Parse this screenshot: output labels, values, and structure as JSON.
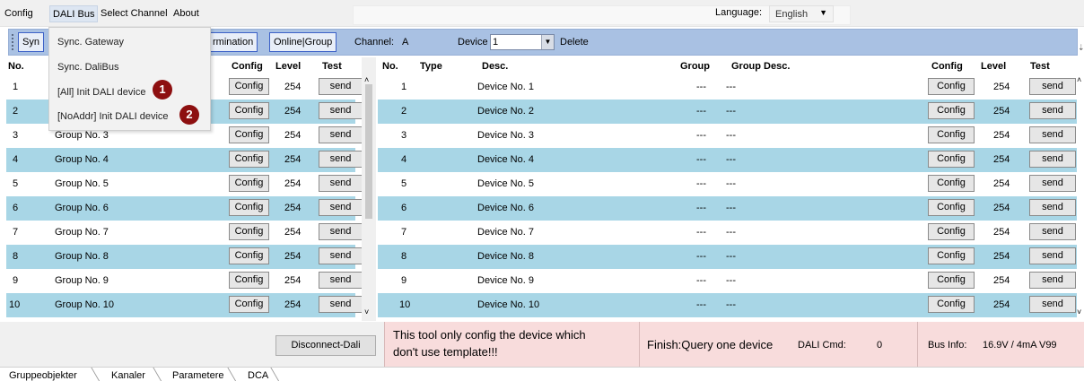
{
  "menubar": {
    "items": [
      "Config",
      "DALI Bus",
      "Select Channel",
      "About"
    ],
    "language_label": "Language:",
    "language_value": "English"
  },
  "dropdown": {
    "items": [
      "Sync. Gateway",
      "Sync. DaliBus",
      "[All] Init DALI device",
      "[NoAddr] Init DALI device"
    ],
    "badges": [
      "1",
      "2"
    ]
  },
  "toolbar": {
    "sync_partial": "Syn",
    "termination_partial": "rmination",
    "online_group": "Online|Group",
    "channel_label": "Channel:",
    "channel_value": "A",
    "device_label": "Device",
    "device_value": "1",
    "delete_label": "Delete"
  },
  "left_table": {
    "headers": {
      "no": "No.",
      "config": "Config",
      "level": "Level",
      "test": "Test"
    },
    "rows": [
      {
        "no": "1",
        "name": "",
        "config": "Config",
        "level": "254",
        "test": "send"
      },
      {
        "no": "2",
        "name": "",
        "config": "Config",
        "level": "254",
        "test": "send"
      },
      {
        "no": "3",
        "name": "Group No. 3",
        "config": "Config",
        "level": "254",
        "test": "send"
      },
      {
        "no": "4",
        "name": "Group No. 4",
        "config": "Config",
        "level": "254",
        "test": "send"
      },
      {
        "no": "5",
        "name": "Group No. 5",
        "config": "Config",
        "level": "254",
        "test": "send"
      },
      {
        "no": "6",
        "name": "Group No. 6",
        "config": "Config",
        "level": "254",
        "test": "send"
      },
      {
        "no": "7",
        "name": "Group No. 7",
        "config": "Config",
        "level": "254",
        "test": "send"
      },
      {
        "no": "8",
        "name": "Group No. 8",
        "config": "Config",
        "level": "254",
        "test": "send"
      },
      {
        "no": "9",
        "name": "Group No. 9",
        "config": "Config",
        "level": "254",
        "test": "send"
      },
      {
        "no": "10",
        "name": "Group No. 10",
        "config": "Config",
        "level": "254",
        "test": "send"
      }
    ]
  },
  "right_table": {
    "headers": {
      "no": "No.",
      "type": "Type",
      "desc": "Desc.",
      "group": "Group",
      "group_desc": "Group Desc.",
      "config": "Config",
      "level": "Level",
      "test": "Test"
    },
    "rows": [
      {
        "no": "1",
        "desc": "Device No. 1",
        "group": "---",
        "group_desc": "---",
        "config": "Config",
        "level": "254",
        "test": "send"
      },
      {
        "no": "2",
        "desc": "Device No. 2",
        "group": "---",
        "group_desc": "---",
        "config": "Config",
        "level": "254",
        "test": "send"
      },
      {
        "no": "3",
        "desc": "Device No. 3",
        "group": "---",
        "group_desc": "---",
        "config": "Config",
        "level": "254",
        "test": "send"
      },
      {
        "no": "4",
        "desc": "Device No. 4",
        "group": "---",
        "group_desc": "---",
        "config": "Config",
        "level": "254",
        "test": "send"
      },
      {
        "no": "5",
        "desc": "Device No. 5",
        "group": "---",
        "group_desc": "---",
        "config": "Config",
        "level": "254",
        "test": "send"
      },
      {
        "no": "6",
        "desc": "Device No. 6",
        "group": "---",
        "group_desc": "---",
        "config": "Config",
        "level": "254",
        "test": "send"
      },
      {
        "no": "7",
        "desc": "Device No. 7",
        "group": "---",
        "group_desc": "---",
        "config": "Config",
        "level": "254",
        "test": "send"
      },
      {
        "no": "8",
        "desc": "Device No. 8",
        "group": "---",
        "group_desc": "---",
        "config": "Config",
        "level": "254",
        "test": "send"
      },
      {
        "no": "9",
        "desc": "Device No. 9",
        "group": "---",
        "group_desc": "---",
        "config": "Config",
        "level": "254",
        "test": "send"
      },
      {
        "no": "10",
        "desc": "Device No. 10",
        "group": "---",
        "group_desc": "---",
        "config": "Config",
        "level": "254",
        "test": "send"
      }
    ]
  },
  "bottom": {
    "disconnect": "Disconnect-Dali",
    "message_line1": "This tool only config the device which",
    "message_line2": "don't use template!!!",
    "finish": "Finish:Query one device",
    "dali_cmd_label": "DALI Cmd:",
    "dali_cmd_value": "0",
    "bus_info_label": "Bus Info:",
    "bus_info_value": "16.9V / 4mA V99"
  },
  "tabs": [
    "Gruppeobjekter",
    "Kanaler",
    "Parametere",
    "DCA"
  ],
  "colors": {
    "row_alt": "#a8d6e6",
    "toolbar": "#a9c1e3",
    "badge": "#8d0f10",
    "status_bg": "#f8dcdc"
  }
}
